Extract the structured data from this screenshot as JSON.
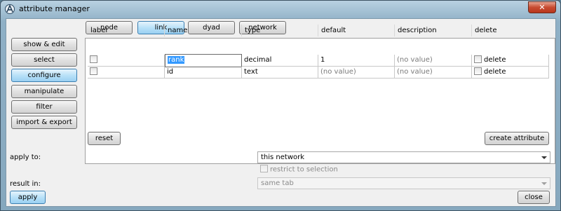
{
  "window": {
    "title": "attribute manager",
    "close_glyph": "✕"
  },
  "top_tabs": [
    {
      "label": "node",
      "active": false
    },
    {
      "label": "link",
      "active": true
    },
    {
      "label": "dyad",
      "active": false
    },
    {
      "label": "network",
      "active": false
    }
  ],
  "side_menu": [
    {
      "label": "show & edit",
      "active": false
    },
    {
      "label": "select",
      "active": false
    },
    {
      "label": "configure",
      "active": true
    },
    {
      "label": "manipulate",
      "active": false
    },
    {
      "label": "filter",
      "active": false
    },
    {
      "label": "import & export",
      "active": false
    }
  ],
  "table": {
    "columns": [
      "label",
      "name",
      "type",
      "default",
      "description",
      "delete"
    ],
    "rows": [
      {
        "label_checked": false,
        "name": "rank",
        "type": "decimal",
        "default": "1",
        "description": "(no value)",
        "delete_label": "delete"
      },
      {
        "label_checked": false,
        "name": "id",
        "type": "text",
        "default": "(no value)",
        "description": "(no value)",
        "delete_label": "delete"
      }
    ]
  },
  "table_buttons": {
    "reset": "reset",
    "create": "create attribute"
  },
  "apply_to": {
    "label": "apply to:",
    "value": "this network"
  },
  "restrict": {
    "label": "restrict to selection",
    "checked": false
  },
  "result_in": {
    "label": "result in:",
    "value": "same tab"
  },
  "footer": {
    "apply": "apply",
    "close": "close"
  },
  "colors": {
    "accent": "#3399ff",
    "active_button": "#b9e1f8",
    "title_close": "#c74b31"
  }
}
